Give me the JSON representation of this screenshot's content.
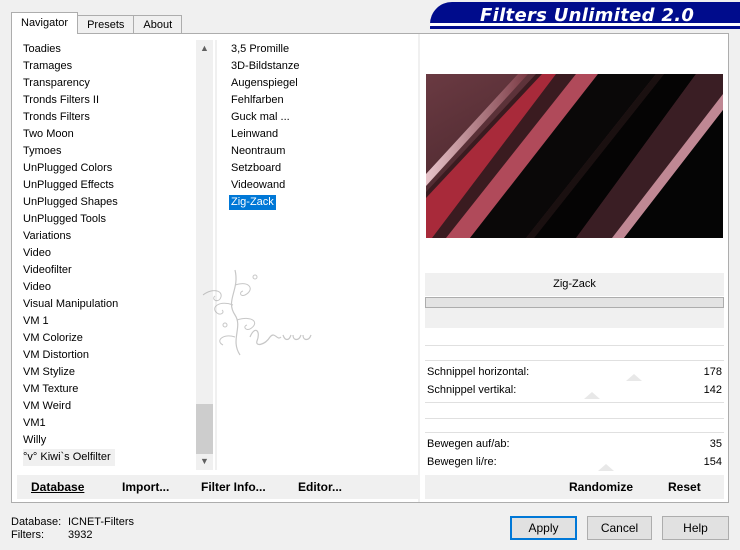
{
  "tabs": {
    "navigator": "Navigator",
    "presets": "Presets",
    "about": "About"
  },
  "banner": {
    "title": "Filters Unlimited 2.0"
  },
  "categories": [
    "Toadies",
    "Tramages",
    "Transparency",
    "Tronds Filters II",
    "Tronds Filters",
    "Two Moon",
    "Tymoes",
    "UnPlugged Colors",
    "UnPlugged Effects",
    "UnPlugged Shapes",
    "UnPlugged Tools",
    "Variations",
    "Video",
    "Videofilter",
    "Video",
    "Visual Manipulation",
    "VM 1",
    "VM Colorize",
    "VM Distortion",
    "VM Stylize",
    "VM Texture",
    "VM Weird",
    "VM1",
    "Willy",
    "°v° Kiwi`s Oelfilter"
  ],
  "filters": [
    "3,5 Promille",
    "3D-Bildstanze",
    "Augenspiegel",
    "Fehlfarben",
    "Guck mal ...",
    "Leinwand",
    "Neontraum",
    "Setzboard",
    "Videowand",
    "Zig-Zack"
  ],
  "selected_filter": "Zig-Zack",
  "params": {
    "p1_label": "Schnippel horizontal:",
    "p1_value": "178",
    "p2_label": "Schnippel vertikal:",
    "p2_value": "142",
    "p3_label": "Bewegen auf/ab:",
    "p3_value": "35",
    "p4_label": "Bewegen li/re:",
    "p4_value": "154"
  },
  "buttons": {
    "database": "Database",
    "import": "Import...",
    "filter_info": "Filter Info...",
    "editor": "Editor...",
    "randomize": "Randomize",
    "reset": "Reset",
    "apply": "Apply",
    "cancel": "Cancel",
    "help": "Help"
  },
  "status": {
    "database_label": "Database:",
    "database_value": "ICNET-Filters",
    "filters_label": "Filters:",
    "filters_value": "3932"
  },
  "icons": {
    "scroll_up": "scroll-up-arrow-icon",
    "scroll_down": "scroll-down-arrow-icon"
  },
  "colors": {
    "banner": "#000c8c",
    "selection": "#0078d7"
  }
}
